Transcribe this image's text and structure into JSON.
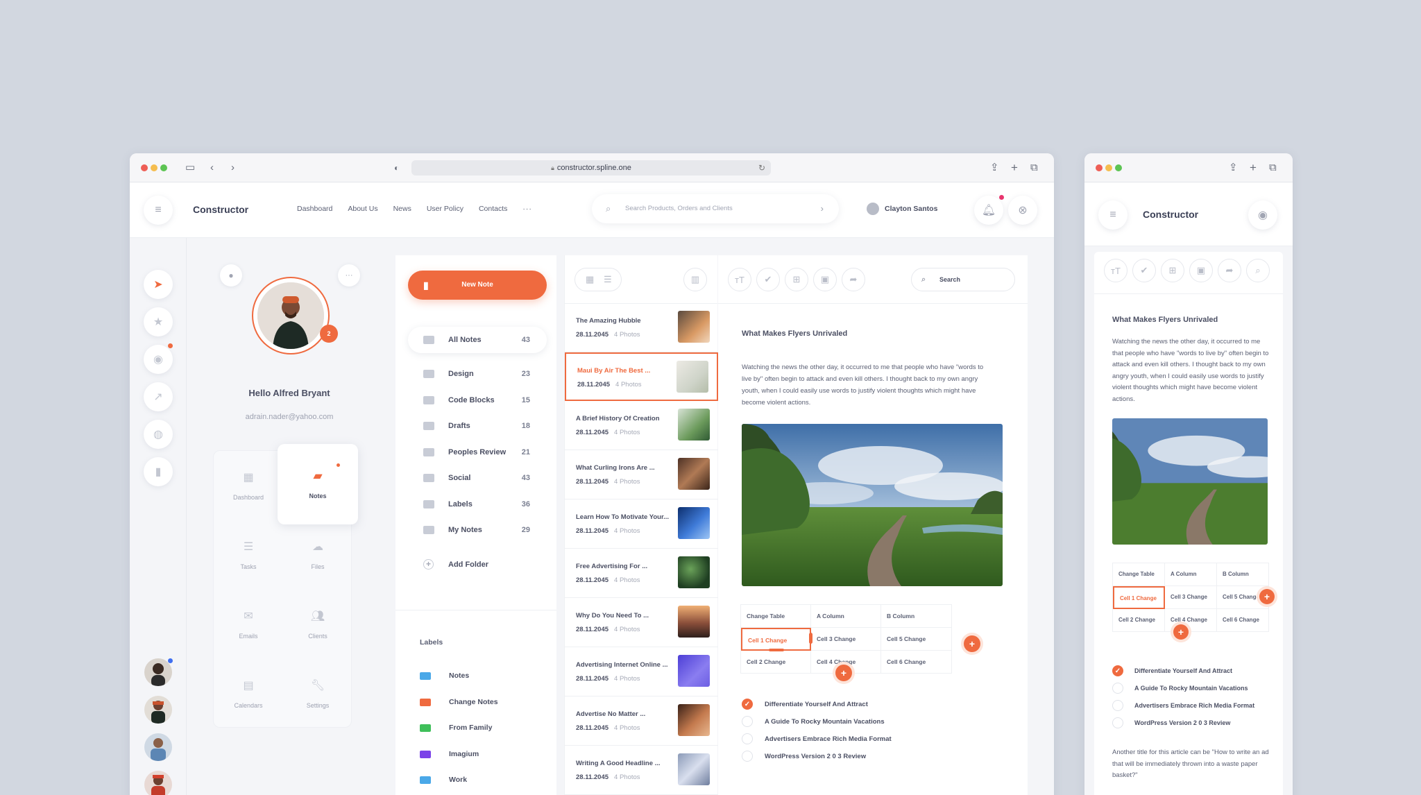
{
  "browser": {
    "url": "constructor.spline.one"
  },
  "header": {
    "brand": "Constructor",
    "nav": [
      "Dashboard",
      "About Us",
      "News",
      "User Policy",
      "Contacts"
    ],
    "more": "···",
    "search_placeholder": "Search Products, Orders and Clients",
    "user_name": "Clayton Santos"
  },
  "profile": {
    "badge_count": "2",
    "greeting": "Hello Alfred Bryant",
    "email": "adrain.nader@yahoo.com",
    "tiles": [
      "Dashboard",
      "Notes",
      "Tasks",
      "Files",
      "Emails",
      "Clients",
      "Calendars",
      "Settings"
    ]
  },
  "folders": {
    "new_note": "New Note",
    "items": [
      {
        "name": "All Notes",
        "count": "43"
      },
      {
        "name": "Design",
        "count": "23"
      },
      {
        "name": "Code Blocks",
        "count": "15"
      },
      {
        "name": "Drafts",
        "count": "18"
      },
      {
        "name": "Peoples Review",
        "count": "21"
      },
      {
        "name": "Social",
        "count": "43"
      },
      {
        "name": "Labels",
        "count": "36"
      },
      {
        "name": "My Notes",
        "count": "29"
      }
    ],
    "add_folder": "Add Folder",
    "labels_title": "Labels",
    "labels": [
      {
        "name": "Notes",
        "color": "#4aa8e8"
      },
      {
        "name": "Change Notes",
        "color": "#ef6a3f"
      },
      {
        "name": "From Family",
        "color": "#3fbf5a"
      },
      {
        "name": "Imagium",
        "color": "#7b42e8"
      },
      {
        "name": "Work",
        "color": "#4aa8e8"
      }
    ]
  },
  "notes": [
    {
      "title": "The Amazing Hubble",
      "date": "28.11.2045",
      "photos": "4 Photos"
    },
    {
      "title": "Maui By Air The Best ...",
      "date": "28.11.2045",
      "photos": "4 Photos"
    },
    {
      "title": "A Brief History Of Creation",
      "date": "28.11.2045",
      "photos": "4 Photos"
    },
    {
      "title": "What Curling Irons Are ...",
      "date": "28.11.2045",
      "photos": "4 Photos"
    },
    {
      "title": "Learn How To Motivate Your...",
      "date": "28.11.2045",
      "photos": "4 Photos"
    },
    {
      "title": "Free Advertising For ...",
      "date": "28.11.2045",
      "photos": "4 Photos"
    },
    {
      "title": "Why Do You Need To ...",
      "date": "28.11.2045",
      "photos": "4 Photos"
    },
    {
      "title": "Advertising Internet Online ...",
      "date": "28.11.2045",
      "photos": "4 Photos"
    },
    {
      "title": "Advertise No Matter ...",
      "date": "28.11.2045",
      "photos": "4 Photos"
    },
    {
      "title": "Writing A Good Headline ...",
      "date": "28.11.2045",
      "photos": "4 Photos"
    }
  ],
  "editor": {
    "search": "Search",
    "title": "What Makes Flyers Unrivaled",
    "body": "Watching the news the other day, it occurred to me that people who have \"words to live by\" often begin to attack and even kill others. I thought back to my own angry youth, when I could easily use words to justify violent thoughts which might have become violent actions.",
    "table": [
      [
        "Change Table",
        "A Column",
        "B Column"
      ],
      [
        "Cell 1 Change",
        "Cell 3 Change",
        "Cell 5 Change"
      ],
      [
        "Cell 2 Change",
        "Cell 4 Change",
        "Cell 6 Change"
      ]
    ],
    "checklist": [
      {
        "text": "Differentiate Yourself And Attract",
        "checked": true
      },
      {
        "text": "A Guide To Rocky Mountain Vacations",
        "checked": false
      },
      {
        "text": "Advertisers Embrace Rich Media Format",
        "checked": false
      },
      {
        "text": "WordPress Version 2 0 3 Review",
        "checked": false
      }
    ],
    "footer_text": "Another title for this article can be \"How to write an ad that will be immediately thrown into a waste paper basket?\""
  },
  "colors": {
    "accent": "#ef6a3f",
    "notify": "#e8356e"
  }
}
